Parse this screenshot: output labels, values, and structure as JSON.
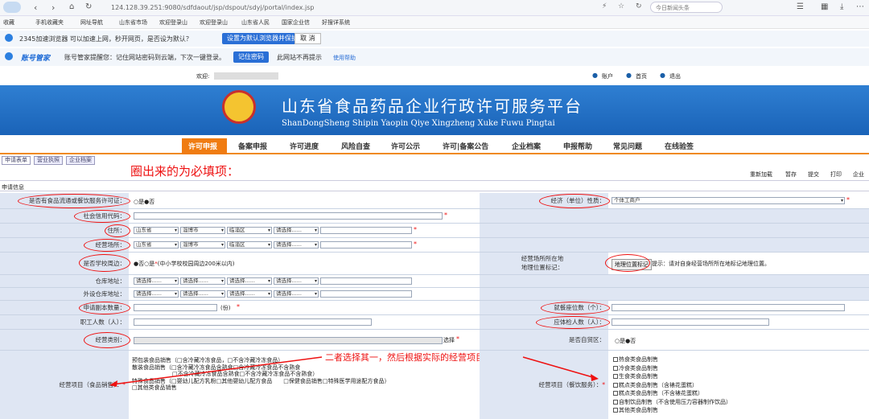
{
  "browser": {
    "url": "124.128.39.251:9080/sdfdaout/jsp/dspout/sdyj/portal/index.jsp",
    "news": "今日新闻头条"
  },
  "bookmarks": [
    "收藏",
    "手机收藏夹",
    "网址导航",
    "山东省市场",
    "欢迎登录山",
    "欢迎登录山",
    "山东省人民",
    "国家企业信",
    "好搜详系统"
  ],
  "notif1": {
    "text": "2345加速浏览器 可以加速上网，秒开网页，是否设为默认？",
    "btn": "设置为默认浏览器并保护",
    "cancel": "取 消"
  },
  "notif2": {
    "brand": "账号管家",
    "text": "账号管家提醒您：记住网站密码到云端，下次一键登录。",
    "btn": "记住密码",
    "no": "此网站不再提示",
    "help": "使用帮助"
  },
  "welcome": {
    "label": "欢迎:",
    "account": "账户",
    "home": "首页",
    "logout": "退出"
  },
  "banner": {
    "title": "山东省食品药品企业行政许可服务平台",
    "subtitle": "ShanDongSheng Shipin Yaopin Qiye Xingzheng Xuke Fuwu Pingtai"
  },
  "nav": [
    "许可申报",
    "备案申报",
    "许可进度",
    "风险自查",
    "许可公示",
    "许可|备案公告",
    "企业档案",
    "申报帮助",
    "常见问题",
    "在线验签"
  ],
  "tabs": [
    "申请表单",
    "营业执照",
    "企业档案"
  ],
  "annot1": "圈出来的为必填项：",
  "toolbar": {
    "reload": "重新加载",
    "save": "暂存",
    "submit": "提交",
    "print": "打印",
    "ent": "企业"
  },
  "section": "申请信息",
  "form": {
    "q1": "是否有食品流通或餐饮服务许可证：",
    "q1_yes": "是",
    "q1_no": "否",
    "econ": "经济（单位）性质：",
    "econ_val": "个体工商户",
    "credit": "社会信用代码：",
    "addr": "住所：",
    "province": "山东省",
    "city": "淄博市",
    "district": "临淄区",
    "choose": "请选择......",
    "bizaddr": "经营场所：",
    "school": "是否学校周边：",
    "school_no": "否",
    "school_yes": "是",
    "school_note": "(中小学校校园周边200米以内)",
    "geo": "经营场所所在地\n地理位置标记：",
    "geo_btn": "地理位置标记",
    "geo_tip": "提示：请对自身经营场所所在地标记地理位置。",
    "warehouse": "仓库地址：",
    "ext_warehouse": "外设仓库地址：",
    "copies": "申请副本数量：",
    "copies_unit": "(份)",
    "seats": "就餐座位数（个）：",
    "staff": "职工人数（人）：",
    "exam": "应体检人数（人）：",
    "category": "经营类别：",
    "select": "选择",
    "ftz": "是否自贸区：",
    "ftz_yes": "是",
    "ftz_no": "否",
    "sales": "经营项目（食品销售）：",
    "catering": "经营项目（餐饮服务）：",
    "sales_items": [
      "预包装食品销售（□含冷藏冷冻食品，□不含冷藏冷冻食品）",
      "散装食品销售（□含冷藏冷冻食品含熟食□含冷藏冷冻食品不含熟食",
      "□不含冷藏冷冻食品含熟食□不含冷藏冷冻食品不含熟食）",
      "特殊食品销售（□婴幼儿配方乳粉□其他婴幼儿配方食品　　□保健食品销售□特殊医学用途配方食品）",
      "□其他类食品销售"
    ],
    "catering_items": [
      "热食类食品制售",
      "冷食类食品制售",
      "生食类食品制售",
      "糕点类食品制售（含裱花蛋糕）",
      "糕点类食品制售（不含裱花蛋糕）",
      "自制饮品制售（不含使用压力容器制作饮品）",
      "其他类食品制售"
    ]
  },
  "annot2": "二者选择其一，然后根据实际的经营项目进行勾选"
}
